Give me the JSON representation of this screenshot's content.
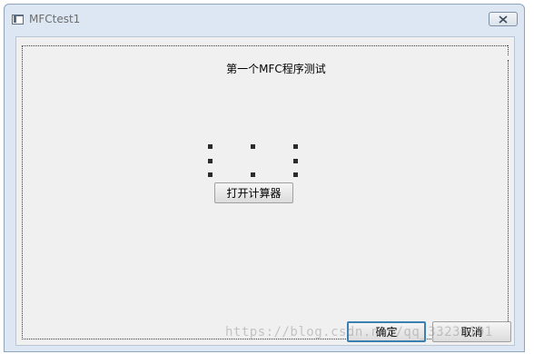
{
  "window": {
    "title": "MFCtest1",
    "close_icon": "close-icon"
  },
  "dialog": {
    "static_text": "第一个MFC程序测试",
    "open_calculator_label": "打开计算器",
    "ok_label": "确定",
    "cancel_label": "取消"
  },
  "watermark": {
    "text": "https://blog.csdn.net/qq_33236191"
  },
  "colors": {
    "titlebar": "#dce7f3",
    "client_bg": "#f0f0f0",
    "default_button_border": "#3c7fb1"
  }
}
